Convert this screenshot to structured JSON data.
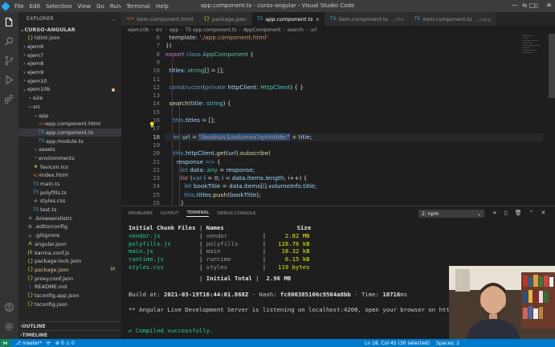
{
  "titlebar": {
    "menu": [
      "File",
      "Edit",
      "Selection",
      "View",
      "Go",
      "Run",
      "Terminal",
      "Help"
    ],
    "window_title": "app.component.ts - curso-angular - Visual Studio Code"
  },
  "sidebar": {
    "header": "EXPLORER",
    "header_dots": "...",
    "project": "CURSO-ANGULAR",
    "items": [
      {
        "label": "tslint.json",
        "type": "file",
        "icon": "{}",
        "iconColor": "#cbcb41",
        "depth": 1
      },
      {
        "label": "ejem6",
        "type": "folder",
        "depth": 0
      },
      {
        "label": "ejem7",
        "type": "folder",
        "depth": 0
      },
      {
        "label": "ejem8",
        "type": "folder",
        "depth": 0
      },
      {
        "label": "ejem9",
        "type": "folder",
        "depth": 0
      },
      {
        "label": "ejem10",
        "type": "folder",
        "depth": 0
      },
      {
        "label": "ejem10b",
        "type": "folder-open",
        "depth": 0,
        "dot": true
      },
      {
        "label": "e2e",
        "type": "folder",
        "depth": 1
      },
      {
        "label": "src",
        "type": "folder-open",
        "depth": 1
      },
      {
        "label": "app",
        "type": "folder-open",
        "depth": 2
      },
      {
        "label": "app.component.html",
        "type": "file",
        "icon": "<>",
        "iconColor": "#e37933",
        "depth": 3
      },
      {
        "label": "app.component.ts",
        "type": "file",
        "icon": "TS",
        "iconColor": "#519aba",
        "depth": 3,
        "selected": true
      },
      {
        "label": "app.module.ts",
        "type": "file",
        "icon": "TS",
        "iconColor": "#519aba",
        "depth": 3
      },
      {
        "label": "assets",
        "type": "folder",
        "depth": 2
      },
      {
        "label": "environments",
        "type": "folder",
        "depth": 2
      },
      {
        "label": "favicon.ico",
        "type": "file",
        "icon": "★",
        "iconColor": "#cbcb41",
        "depth": 2
      },
      {
        "label": "index.html",
        "type": "file",
        "icon": "<>",
        "iconColor": "#e37933",
        "depth": 2
      },
      {
        "label": "main.ts",
        "type": "file",
        "icon": "TS",
        "iconColor": "#519aba",
        "depth": 2
      },
      {
        "label": "polyfills.ts",
        "type": "file",
        "icon": "TS",
        "iconColor": "#519aba",
        "depth": 2
      },
      {
        "label": "styles.css",
        "type": "file",
        "icon": "#",
        "iconColor": "#519aba",
        "depth": 2
      },
      {
        "label": "test.ts",
        "type": "file",
        "icon": "TS",
        "iconColor": "#519aba",
        "depth": 2
      },
      {
        "label": ".browserslistrc",
        "type": "file",
        "icon": "≡",
        "iconColor": "#a0a0a0",
        "depth": 1
      },
      {
        "label": ".editorconfig",
        "type": "file",
        "icon": "⚙",
        "iconColor": "#a0a0a0",
        "depth": 1
      },
      {
        "label": ".gitignore",
        "type": "file",
        "icon": "◆",
        "iconColor": "#41535b",
        "depth": 1
      },
      {
        "label": "angular.json",
        "type": "file",
        "icon": "A",
        "iconColor": "#cbcb41",
        "depth": 1
      },
      {
        "label": "karma.conf.js",
        "type": "file",
        "icon": "JS",
        "iconColor": "#cbcb41",
        "depth": 1
      },
      {
        "label": "package-lock.json",
        "type": "file",
        "icon": "{}",
        "iconColor": "#cbcb41",
        "depth": 1
      },
      {
        "label": "package.json",
        "type": "file",
        "icon": "{}",
        "iconColor": "#cbcb41",
        "depth": 1,
        "modified": true,
        "badge": "M"
      },
      {
        "label": "proxy.conf.json",
        "type": "file",
        "icon": "{}",
        "iconColor": "#cbcb41",
        "depth": 1
      },
      {
        "label": "README.md",
        "type": "file",
        "icon": "i",
        "iconColor": "#519aba",
        "depth": 1
      },
      {
        "label": "tsconfig.app.json",
        "type": "file",
        "icon": "{}",
        "iconColor": "#cbcb41",
        "depth": 1
      },
      {
        "label": "tsconfig.json",
        "type": "file",
        "icon": "{}",
        "iconColor": "#cbcb41",
        "depth": 1
      }
    ],
    "outline": "OUTLINE",
    "timeline": "TIMELINE"
  },
  "tabs": [
    {
      "label": "item.component.html",
      "icon": "<>",
      "iconColor": "#e37933",
      "sub": ""
    },
    {
      "label": "package.json",
      "icon": "{}",
      "iconColor": "#cbcb41",
      "sub": ""
    },
    {
      "label": "app.component.ts",
      "icon": "TS",
      "iconColor": "#519aba",
      "sub": "",
      "active": true
    },
    {
      "label": "item.component.ts",
      "icon": "TS",
      "iconColor": "#519aba",
      "sub": ".../ite"
    },
    {
      "label": "item.component.ts",
      "icon": "TS",
      "iconColor": "#519aba",
      "sub": ".../app"
    }
  ],
  "breadcrumb": [
    "ejem10b",
    "src",
    "app",
    "TS app.component.ts",
    "AppComponent",
    "search",
    "url"
  ],
  "editor": {
    "line_numbers": [
      "6",
      "7",
      "8",
      "9",
      "10",
      "11",
      "12",
      "13",
      "14",
      "15",
      "16",
      "17",
      "18",
      "19",
      "20",
      "21",
      "22",
      "23",
      "24",
      "25",
      "26",
      "27",
      "28"
    ],
    "current_line": "18"
  },
  "panel": {
    "tabs": [
      "PROBLEMS",
      "OUTPUT",
      "TERMINAL",
      "DEBUG CONSOLE"
    ],
    "active_tab": "TERMINAL",
    "terminal_select": "2: npm",
    "table_headers": [
      "Initial Chunk Files",
      "Names",
      "Size"
    ],
    "chunks": [
      {
        "file": "vendor.js",
        "name": "vendor",
        "size": "2.82 MB"
      },
      {
        "file": "polyfills.js",
        "name": "polyfills",
        "size": "128.76 kB"
      },
      {
        "file": "main.js",
        "name": "main",
        "size": "18.32 kB"
      },
      {
        "file": "runtime.js",
        "name": "runtime",
        "size": "6.15 kB"
      },
      {
        "file": "styles.css",
        "name": "styles",
        "size": "119 bytes"
      }
    ],
    "initial_total_label": "Initial Total",
    "initial_total": "2.96 MB",
    "build_prefix": "Build at: ",
    "build_date": "2021-03-19T16:44:01.868Z",
    "hash_prefix": " - Hash: ",
    "hash": "fc800385106c9504a8bb",
    "time_prefix": " - Time: ",
    "time": "10716",
    "time_unit": "ms",
    "server_msg": "** Angular Live Development Server is listening on localhost:4200, open your browser on http://lo",
    "compiled_msg": "✔ Compiled successfully."
  },
  "statusbar": {
    "branch": "master*",
    "sync": "⟳",
    "errors": "⊗ 0 ⚠ 0",
    "cursor": "Ln 18, Col 45 (30 selected)",
    "spaces": "Spaces: 2"
  }
}
